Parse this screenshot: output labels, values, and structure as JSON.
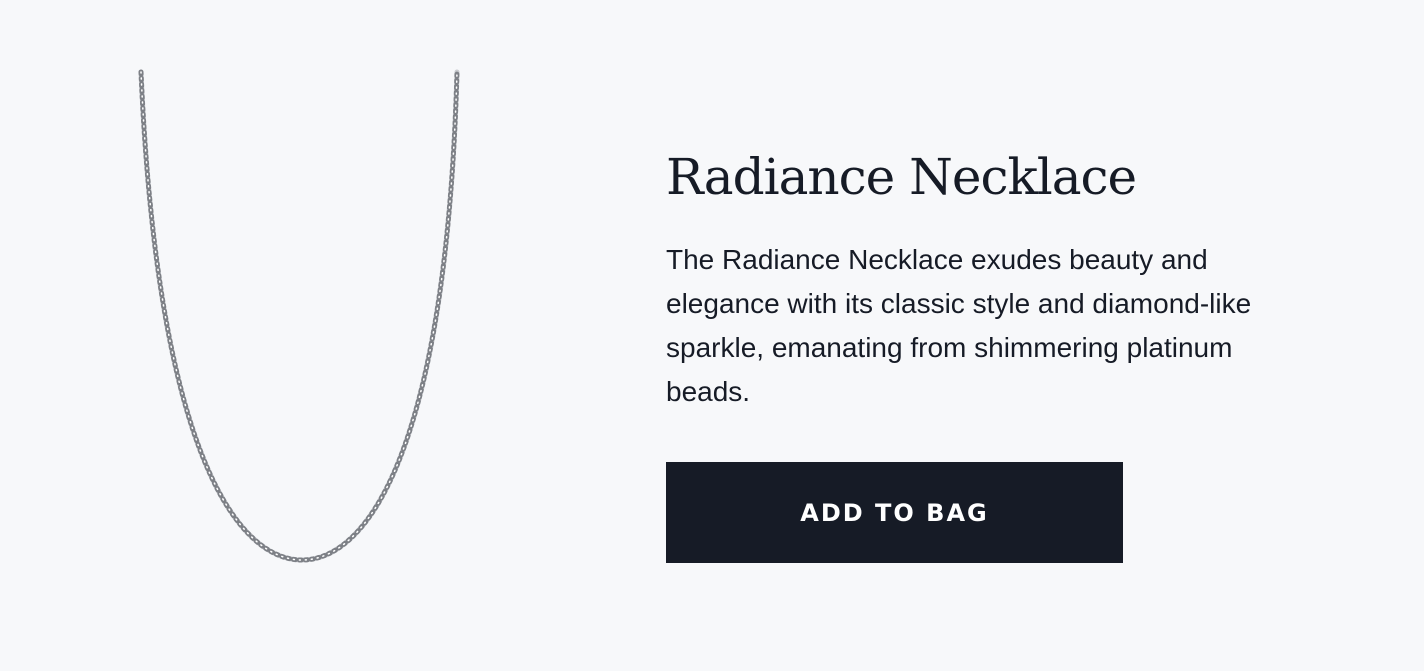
{
  "product": {
    "title": "Radiance Necklace",
    "description": "The Radiance Necklace exudes beauty and elegance with its classic style and diamond-like sparkle, emanating from shimmering platinum beads.",
    "image_icon": "necklace-image",
    "add_to_bag_label": "ADD TO BAG"
  },
  "colors": {
    "background": "#f7f8fa",
    "text": "#161b26",
    "button_bg": "#161b26",
    "button_text": "#ffffff"
  }
}
